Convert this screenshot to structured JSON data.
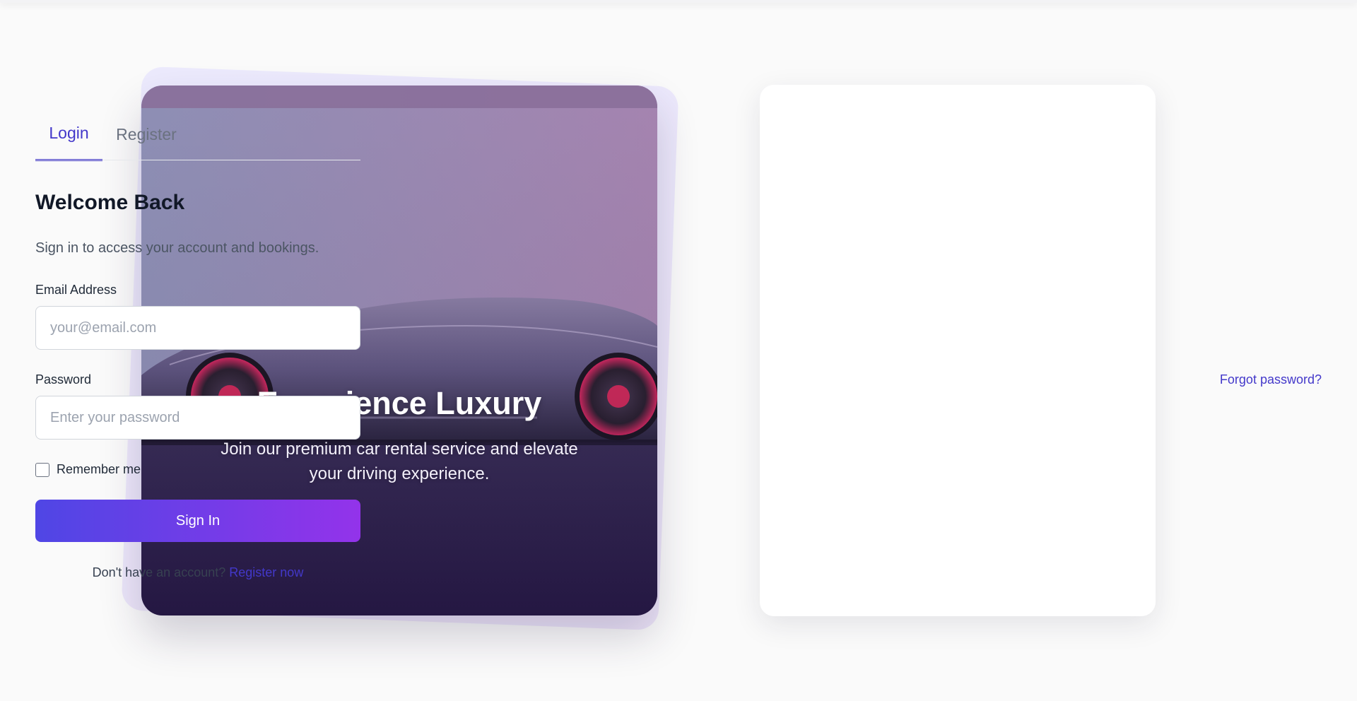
{
  "hero": {
    "title": "Experience Luxury",
    "subtitle": "Join our premium car rental service and elevate your driving experience.",
    "image": "sports-car-photo"
  },
  "tabs": [
    {
      "label": "Login",
      "active": true
    },
    {
      "label": "Register",
      "active": false
    }
  ],
  "login": {
    "heading": "Welcome Back",
    "subtext": "Sign in to access your account and bookings.",
    "email_label": "Email Address",
    "email_placeholder": "your@email.com",
    "email_value": "",
    "password_label": "Password",
    "forgot_label": "Forgot password?",
    "password_placeholder": "Enter your password",
    "password_value": "",
    "remember_label": "Remember me",
    "remember_checked": false,
    "submit_label": "Sign In",
    "footer_text": "Don't have an account?",
    "footer_link": "Register now"
  },
  "colors": {
    "accent": "#4338ca",
    "button_gradient_start": "#4f46e5",
    "button_gradient_end": "#9333ea",
    "page_background": "#fafafa"
  }
}
